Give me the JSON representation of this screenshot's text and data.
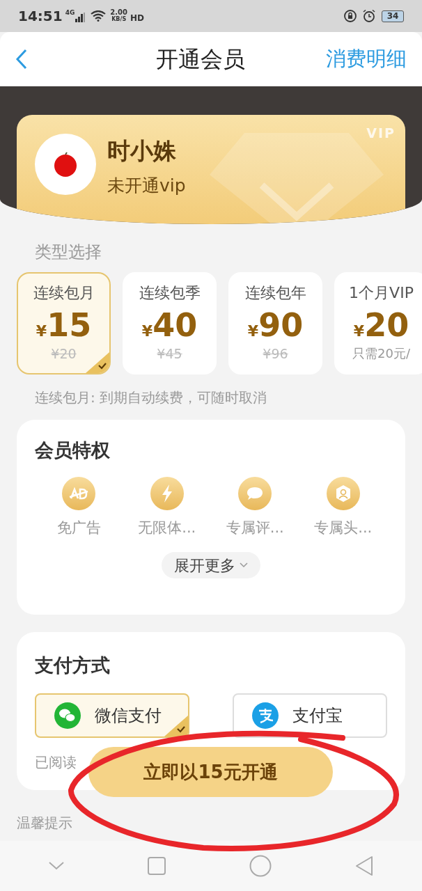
{
  "status_bar": {
    "time": "14:51",
    "network": "4G",
    "speed_value": "2.00",
    "speed_unit": "KB/S",
    "hd": "HD",
    "battery": "34"
  },
  "header": {
    "title": "开通会员",
    "action": "消费明细"
  },
  "profile": {
    "badge": "VIP",
    "name": "时小姝",
    "status": "未开通vip"
  },
  "plan_section": {
    "label": "类型选择",
    "plans": [
      {
        "name": "连续包月",
        "currency": "¥",
        "price": "15",
        "kind": "original",
        "sub": "¥20",
        "selected": true
      },
      {
        "name": "连续包季",
        "currency": "¥",
        "price": "40",
        "kind": "original",
        "sub": "¥45",
        "selected": false
      },
      {
        "name": "连续包年",
        "currency": "¥",
        "price": "90",
        "kind": "original",
        "sub": "¥96",
        "selected": false
      },
      {
        "name": "1个月VIP",
        "currency": "¥",
        "price": "20",
        "kind": "note",
        "sub": "只需20元/",
        "selected": false
      }
    ],
    "note": "连续包月: 到期自动续费，可随时取消"
  },
  "privileges": {
    "title": "会员特权",
    "items": [
      {
        "kind": "ad",
        "label": "免广告"
      },
      {
        "kind": "bolt",
        "label": "无限体..."
      },
      {
        "kind": "comment",
        "label": "专属评..."
      },
      {
        "kind": "avatar",
        "label": "专属头..."
      }
    ],
    "expand": "展开更多"
  },
  "payment": {
    "title": "支付方式",
    "methods": [
      {
        "kind": "wechat",
        "label": "微信支付",
        "selected": true
      },
      {
        "kind": "alipay",
        "label": "支付宝",
        "selected": false
      }
    ],
    "agreement": "已阅读"
  },
  "cta": "立即以15元开通",
  "tip": "温馨提示"
}
